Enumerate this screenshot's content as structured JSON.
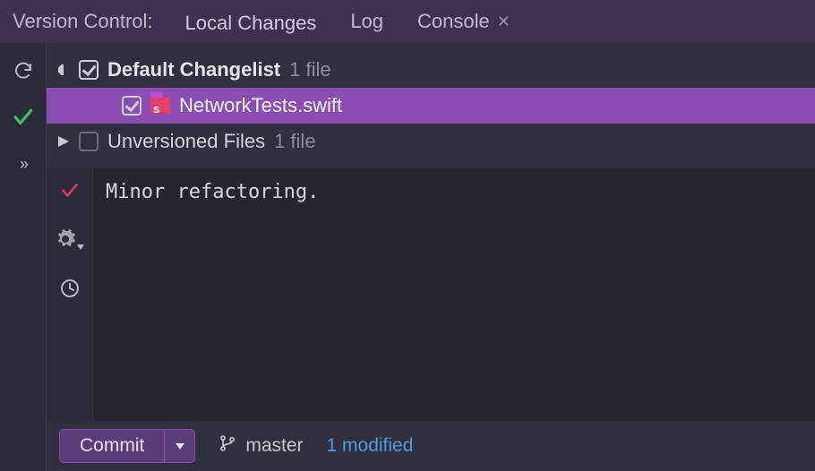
{
  "header": {
    "title": "Version Control:",
    "tabs": {
      "local_changes": "Local Changes",
      "log": "Log",
      "console": "Console"
    }
  },
  "tree": {
    "default_changelist": {
      "label": "Default Changelist",
      "count": "1 file"
    },
    "file": {
      "name": "NetworkTests.swift"
    },
    "unversioned": {
      "label": "Unversioned Files",
      "count": "1 file"
    }
  },
  "commit": {
    "message": "Minor refactoring.",
    "button": "Commit",
    "branch": "master",
    "status": "1 modified"
  }
}
